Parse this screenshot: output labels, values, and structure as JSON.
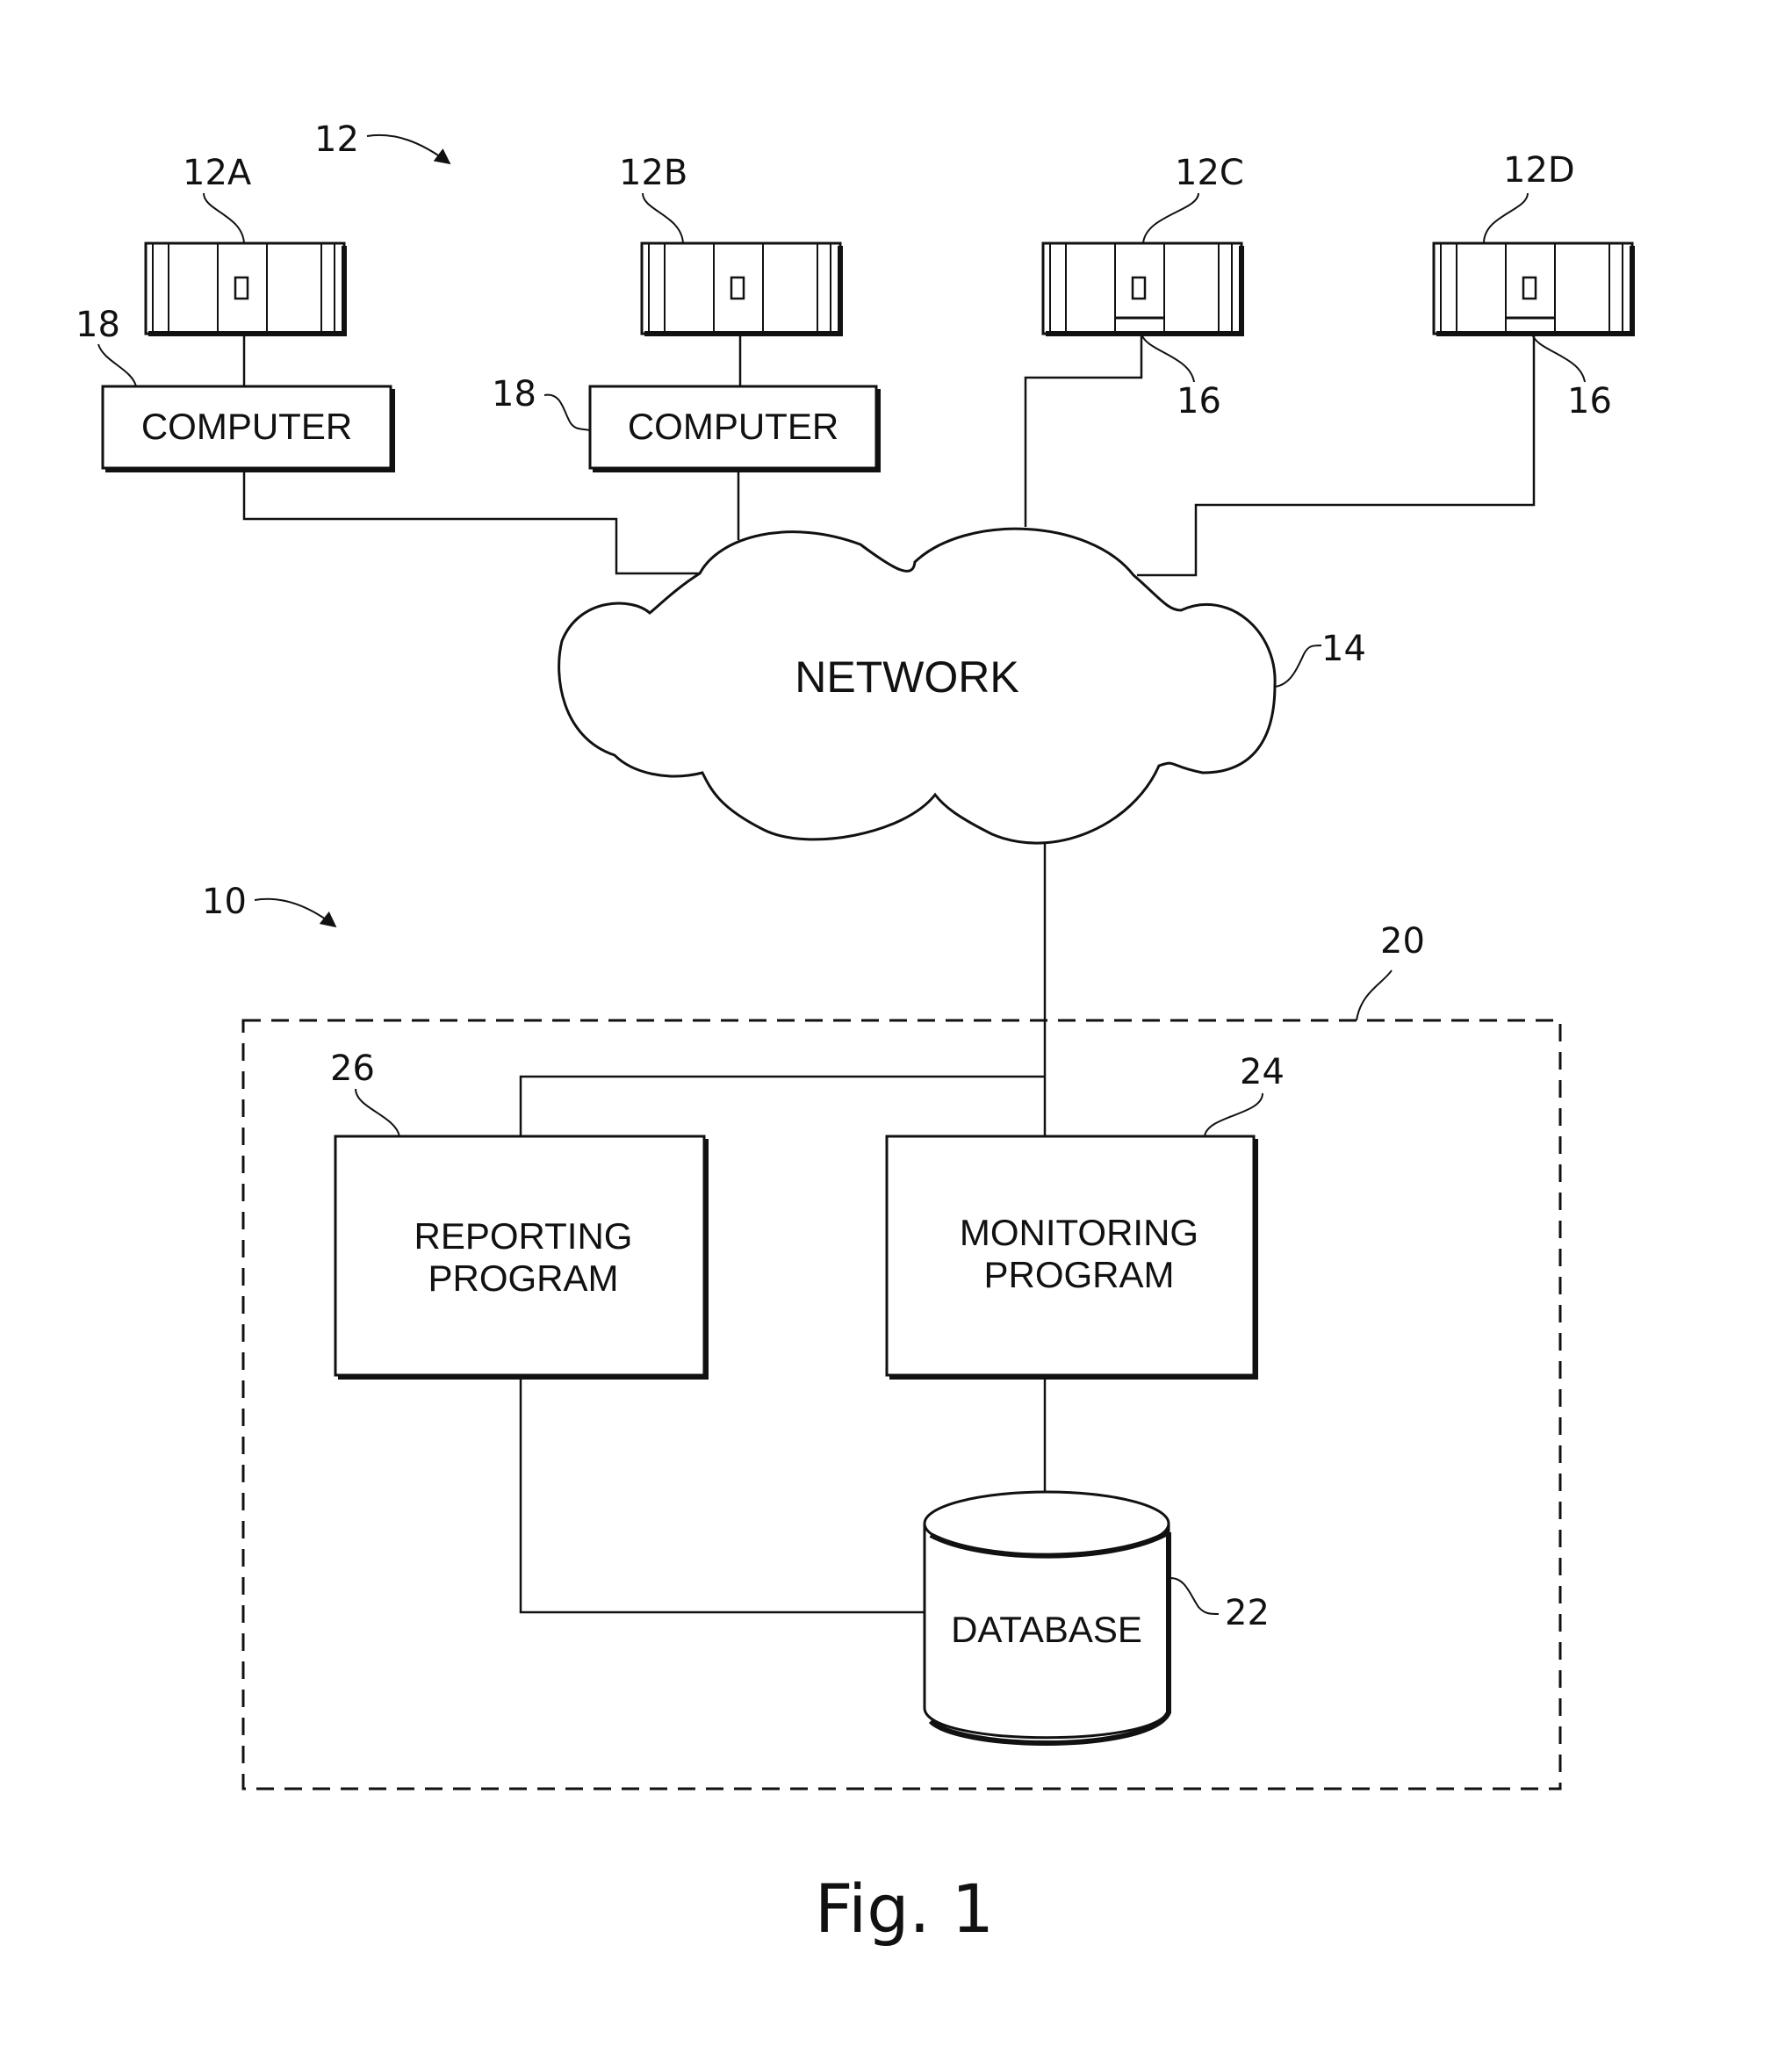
{
  "figure": {
    "caption": "Fig. 1",
    "system_ref": "10",
    "servers_group_ref": "12"
  },
  "servers": [
    {
      "id": "server-12a",
      "ref": "12A",
      "has_agent": false
    },
    {
      "id": "server-12b",
      "ref": "12B",
      "has_agent": false
    },
    {
      "id": "server-12c",
      "ref": "12C",
      "has_agent": true,
      "agent_ref": "16"
    },
    {
      "id": "server-12d",
      "ref": "12D",
      "has_agent": true,
      "agent_ref": "16"
    }
  ],
  "computers": [
    {
      "label": "COMPUTER",
      "ref": "18"
    },
    {
      "label": "COMPUTER",
      "ref": "18"
    }
  ],
  "network": {
    "label": "NETWORK",
    "ref": "14"
  },
  "monitoring_system": {
    "ref": "20",
    "reporting": {
      "line1": "REPORTING",
      "line2": "PROGRAM",
      "ref": "26"
    },
    "monitoring": {
      "line1": "MONITORING",
      "line2": "PROGRAM",
      "ref": "24"
    },
    "database": {
      "label": "DATABASE",
      "ref": "22"
    }
  },
  "colors": {
    "ink": "#111111",
    "paper": "#ffffff"
  }
}
